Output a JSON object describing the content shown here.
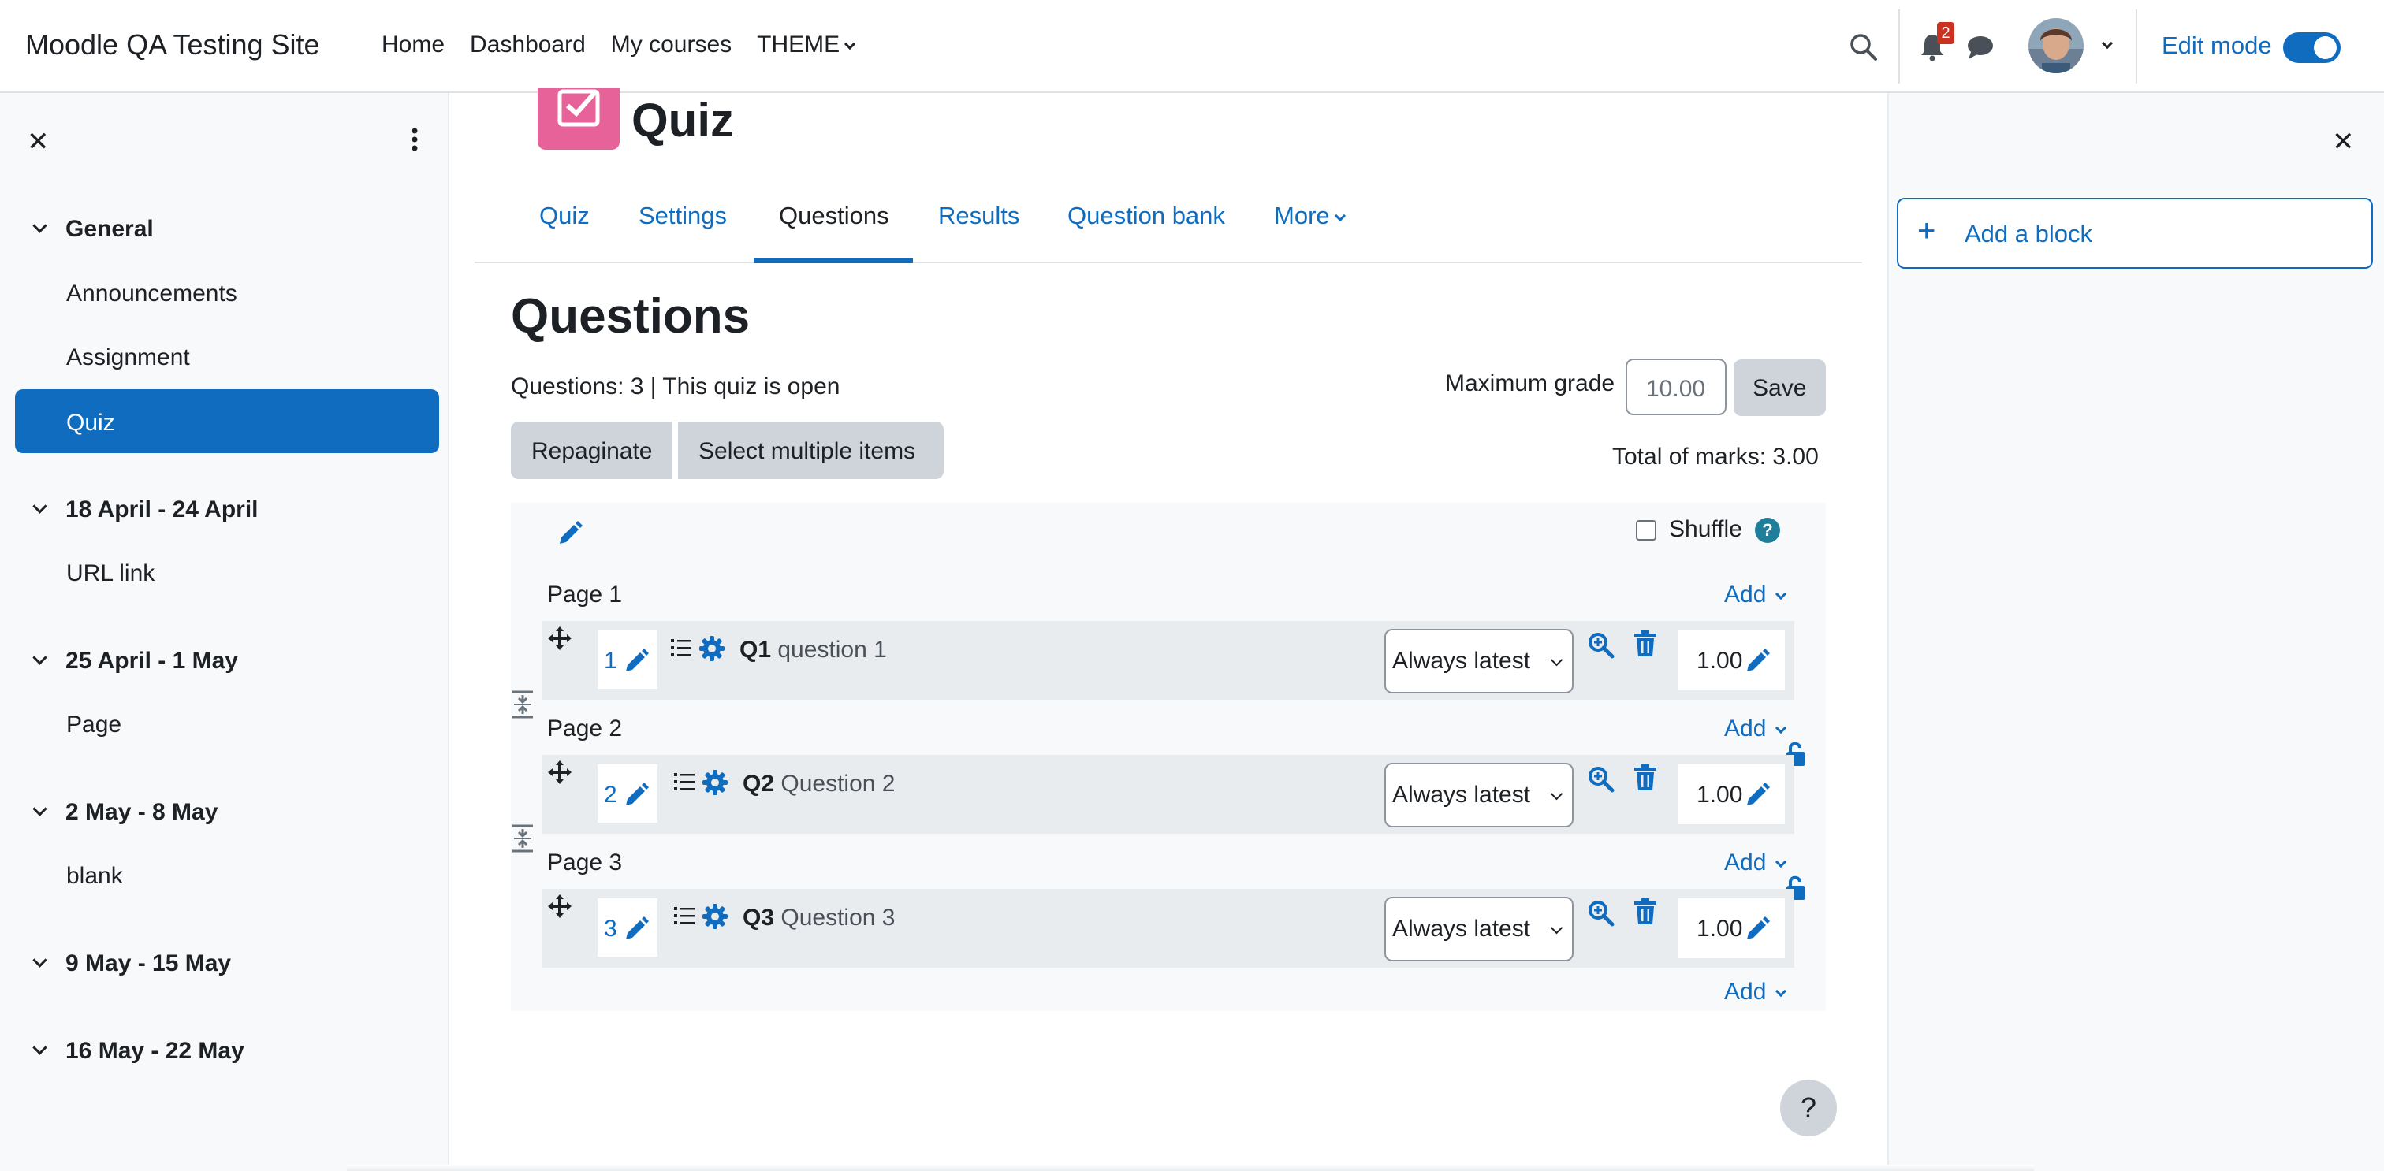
{
  "navbar": {
    "site_name": "Moodle QA Testing Site",
    "links": [
      "Home",
      "Dashboard",
      "My courses",
      "THEME"
    ],
    "notification_count": "2",
    "edit_mode_label": "Edit mode",
    "edit_mode_on": true
  },
  "course_index": {
    "sections": [
      {
        "title": "General",
        "items": [
          "Announcements",
          "Assignment",
          "Quiz"
        ]
      },
      {
        "title": "18 April - 24 April",
        "items": [
          "URL link"
        ]
      },
      {
        "title": "25 April - 1 May",
        "items": [
          "Page"
        ]
      },
      {
        "title": "2 May - 8 May",
        "items": [
          "blank"
        ]
      },
      {
        "title": "9 May - 15 May",
        "items": []
      },
      {
        "title": "16 May - 22 May",
        "items": []
      }
    ],
    "active_item": "Quiz"
  },
  "block_drawer": {
    "add_block_label": "Add a block"
  },
  "activity": {
    "title": "Quiz",
    "icon_color": "#e8629a"
  },
  "secondary_nav": {
    "tabs": [
      "Quiz",
      "Settings",
      "Questions",
      "Results",
      "Question bank",
      "More"
    ],
    "active": "Questions"
  },
  "page": {
    "heading": "Questions",
    "status": "Questions: 3 | This quiz is open",
    "max_grade_label": "Maximum grade",
    "max_grade_value": "10.00",
    "save_label": "Save",
    "repaginate_label": "Repaginate",
    "select_multiple_label": "Select multiple items",
    "total_marks": "Total of marks: 3.00",
    "shuffle_label": "Shuffle",
    "shuffle_checked": false,
    "add_label": "Add"
  },
  "slots": [
    {
      "page": "Page 1",
      "number": "1",
      "qid": "Q1",
      "name": "question 1",
      "version": "Always latest",
      "mark": "1.00"
    },
    {
      "page": "Page 2",
      "number": "2",
      "qid": "Q2",
      "name": "Question 2",
      "version": "Always latest",
      "mark": "1.00"
    },
    {
      "page": "Page 3",
      "number": "3",
      "qid": "Q3",
      "name": "Question 3",
      "version": "Always latest",
      "mark": "1.00"
    }
  ],
  "help": {
    "label": "?"
  },
  "colors": {
    "primary": "#0f6cbf",
    "notification_badge": "#ca3120",
    "help_badge": "#1f7e9a"
  }
}
